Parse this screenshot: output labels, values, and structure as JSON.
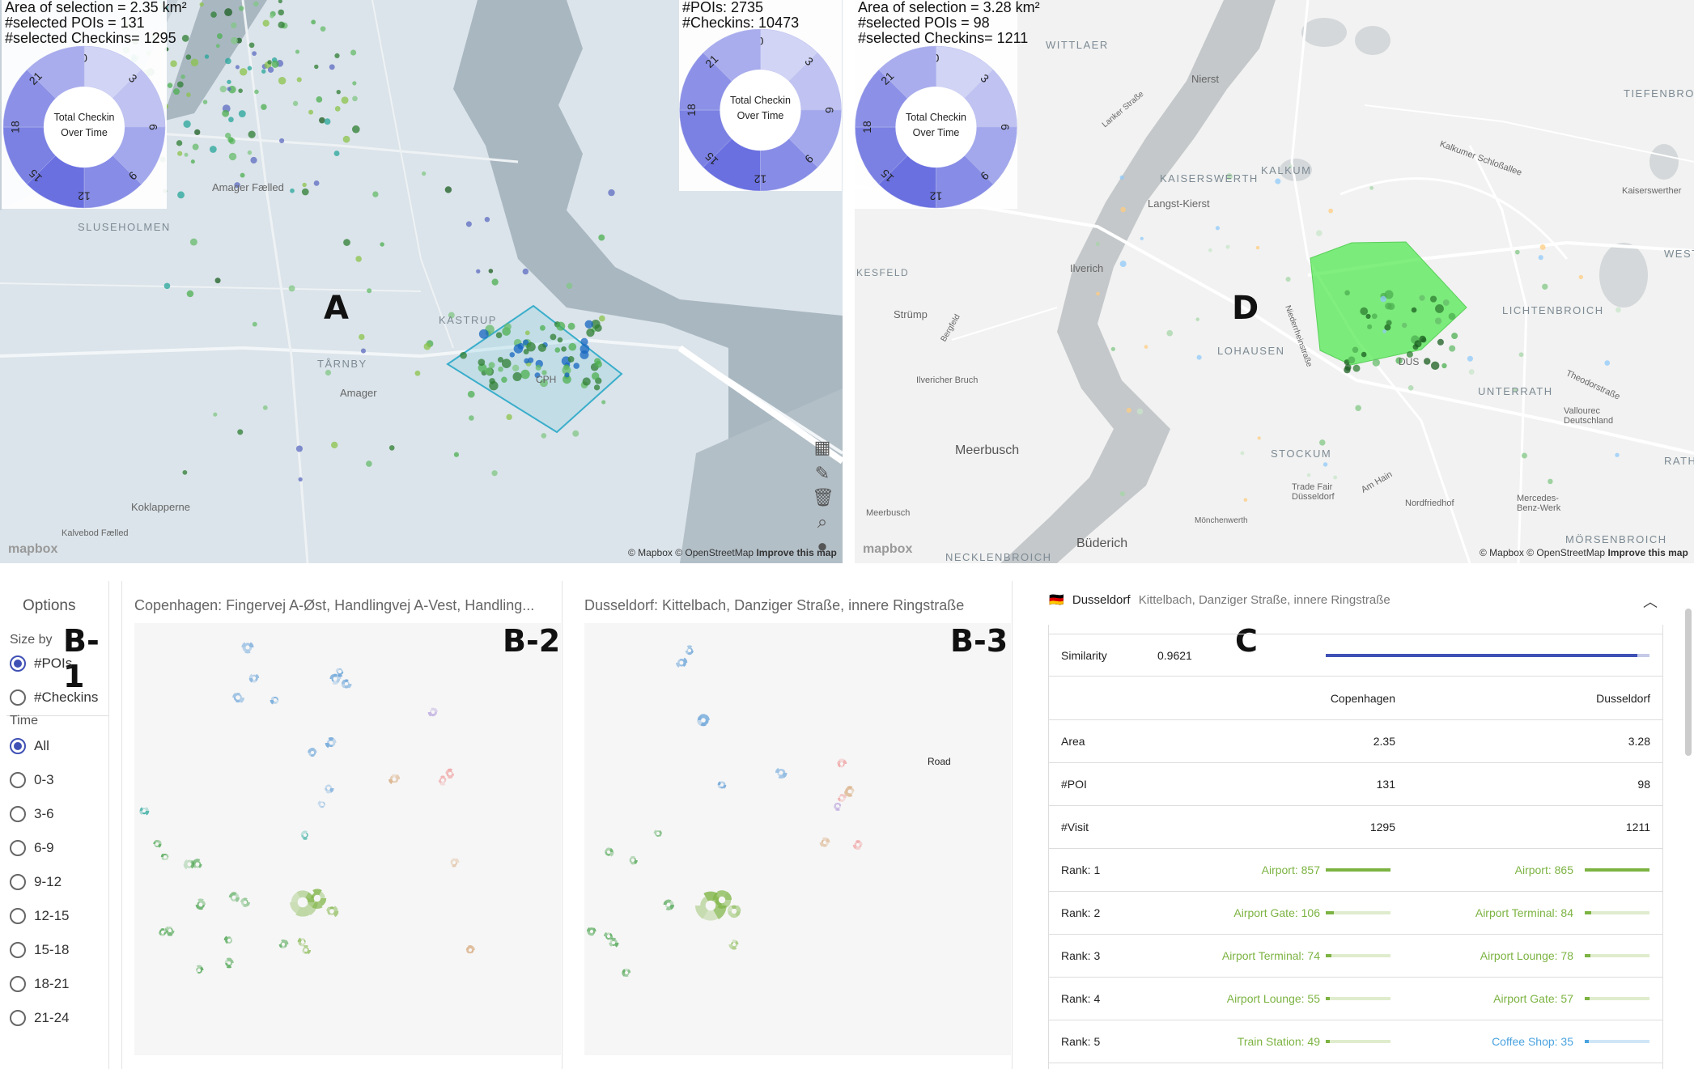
{
  "map_a": {
    "letter": "A",
    "info": {
      "line1": "Area of selection = 2.35 km²",
      "line2": "#selected POIs = 131",
      "line3": "#selected Checkins= 1295"
    },
    "global_info": {
      "line1": "#POIs: 2735",
      "line2": "#Checkins: 10473"
    },
    "labels": {
      "amager_faelled": "Amager Fælled",
      "sluseholmen": "SLUSEHOLMEN",
      "kastrup": "KASTRUP",
      "tarnby": "TÅRNBY",
      "amager": "Amager",
      "koklapperne": "Koklapperne",
      "kalvebod": "Kalvebod Fælled",
      "cph": "CPH"
    },
    "attribution": "© Mapbox © OpenStreetMap",
    "improve": "Improve this map",
    "logo": "mapbox"
  },
  "map_d": {
    "letter": "D",
    "info": {
      "line1": "Area of selection = 3.28 km²",
      "line2": "#selected POIs = 98",
      "line3": "#selected Checkins= 1211"
    },
    "labels": {
      "wittlaer": "WITTLAER",
      "kaiserswerth": "KAISERSWERTH",
      "kalkum": "KALKUM",
      "nierst": "Nierst",
      "langst_kierst": "Langst-Kierst",
      "ilverich": "Ilverich",
      "kesfeld": "KESFELD",
      "strump": "Strümp",
      "lohausen": "LOHAUSEN",
      "lichtenbroich": "LICHTENBROICH",
      "unterrath": "UNTERRATH",
      "meerbusch": "Meerbusch",
      "meerbusch_small": "Meerbusch",
      "buderich": "Büderich",
      "stockum": "STOCKUM",
      "trade_fair": "Trade Fair Düsseldorf",
      "rath": "RATH",
      "mersenbroich": "MÖRSENBROICH",
      "necklenbroich": "NECKLENBROICH",
      "tiefenbroich": "TIEFENBROICH",
      "west": "WEST",
      "dus": "DUS",
      "nordfriedhof": "Nordfriedhof",
      "vallourec": "Vallourec Deutschland",
      "mercedes": "Mercedes-Benz-Werk",
      "ilvericher_bruch": "Ilvericher Bruch",
      "kaiserswerther": "Kaiserswerther",
      "kalkumer": "Kalkumer Schloßallee",
      "theodor": "Theodorstraße",
      "am_hain": "Am Hain",
      "monchenwerth": "Mönchenwerth",
      "lanker": "Lanker Straße",
      "bergfeld": "Bergfeld",
      "niederrhein": "Niederrheinstraße"
    },
    "attribution": "© Mapbox © OpenStreetMap",
    "improve": "Improve this map",
    "logo": "mapbox"
  },
  "clock": {
    "center_label_1": "Total Checkin",
    "center_label_2": "Over Time",
    "hours": [
      "0",
      "3",
      "6",
      "9",
      "12",
      "15",
      "18",
      "21"
    ],
    "color_light": "#dcdff7",
    "color_dark": "#6a70e0"
  },
  "options": {
    "title": "Options",
    "badge": "B-1",
    "size_by_label": "Size by",
    "size_by": [
      {
        "label": "#POIs",
        "selected": true
      },
      {
        "label": "#Checkins",
        "selected": false
      }
    ],
    "time_label": "Time",
    "time": [
      {
        "label": "All",
        "selected": true
      },
      {
        "label": "0-3",
        "selected": false
      },
      {
        "label": "3-6",
        "selected": false
      },
      {
        "label": "6-9",
        "selected": false
      },
      {
        "label": "9-12",
        "selected": false
      },
      {
        "label": "12-15",
        "selected": false
      },
      {
        "label": "15-18",
        "selected": false
      },
      {
        "label": "18-21",
        "selected": false
      },
      {
        "label": "21-24",
        "selected": false
      }
    ]
  },
  "b2": {
    "title": "Copenhagen: Fingervej A-Øst, Handlingvej A-Vest, Handling...",
    "badge": "B-2"
  },
  "b3": {
    "title": "Dusseldorf: Kittelbach, Danziger Straße, innere Ringstraße",
    "badge": "B-3",
    "road_label": "Road"
  },
  "compare": {
    "badge": "C",
    "flag": "🇩🇪",
    "city": "Dusseldorf",
    "subtitle": "Kittelbach, Danziger Straße, innere Ringstraße",
    "similarity_label": "Similarity",
    "similarity": "0.9621",
    "similarity_value": 0.9621,
    "col1": "Copenhagen",
    "col2": "Dusseldorf",
    "rows": [
      {
        "label": "Area",
        "v1": "2.35",
        "v2": "3.28"
      },
      {
        "label": "#POI",
        "v1": "131",
        "v2": "98"
      },
      {
        "label": "#Visit",
        "v1": "1295",
        "v2": "1211"
      }
    ],
    "ranks": [
      {
        "label": "Rank: 1",
        "c1": "Airport: 857",
        "f1": 1.0,
        "col1": "#7cb342",
        "c2": "Airport: 865",
        "f2": 1.0,
        "col2": "#7cb342"
      },
      {
        "label": "Rank: 2",
        "c1": "Airport Gate: 106",
        "f1": 0.12,
        "col1": "#7cb342",
        "c2": "Airport Terminal: 84",
        "f2": 0.1,
        "col2": "#7cb342"
      },
      {
        "label": "Rank: 3",
        "c1": "Airport Terminal: 74",
        "f1": 0.09,
        "col1": "#7cb342",
        "c2": "Airport Lounge: 78",
        "f2": 0.09,
        "col2": "#7cb342"
      },
      {
        "label": "Rank: 4",
        "c1": "Airport Lounge: 55",
        "f1": 0.06,
        "col1": "#7cb342",
        "c2": "Airport Gate: 57",
        "f2": 0.07,
        "col2": "#7cb342"
      },
      {
        "label": "Rank: 5",
        "c1": "Train Station: 49",
        "f1": 0.06,
        "col1": "#7cb342",
        "c2": "Coffee Shop: 35",
        "f2": 0.04,
        "col2": "#4aa3df"
      }
    ]
  }
}
